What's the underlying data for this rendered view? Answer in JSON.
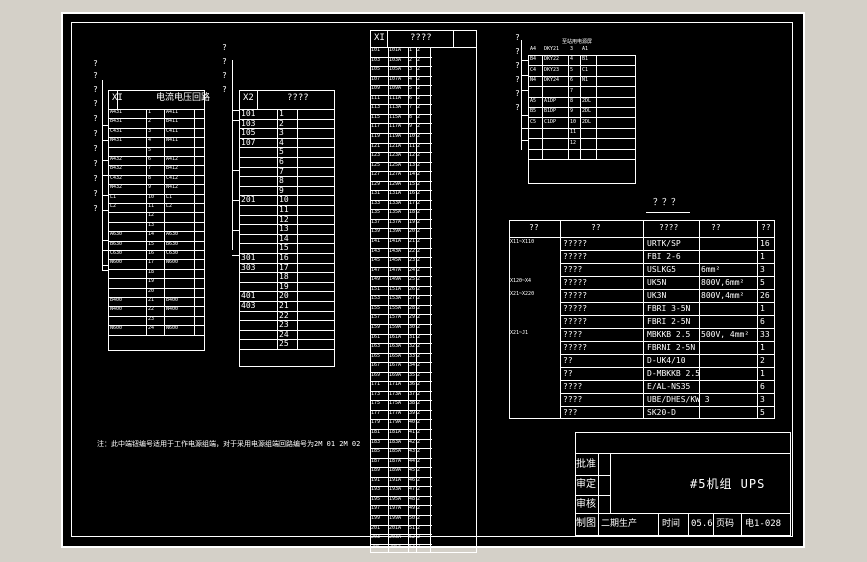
{
  "x1_table": {
    "header_left": "XI",
    "header_title": "电流电压回路",
    "rows": [
      [
        "A431",
        "1",
        "A411"
      ],
      [
        "B431",
        "2",
        "B411"
      ],
      [
        "C431",
        "3",
        "C411"
      ],
      [
        "N431",
        "4",
        "N411"
      ],
      [
        "",
        "5",
        ""
      ],
      [
        "A432",
        "6",
        "A412"
      ],
      [
        "B432",
        "7",
        "B412"
      ],
      [
        "C432",
        "8",
        "C412"
      ],
      [
        "N432",
        "9",
        "N412"
      ],
      [
        "L1",
        "10",
        "L1"
      ],
      [
        "L2",
        "11",
        "L2"
      ],
      [
        "",
        "12",
        ""
      ],
      [
        "",
        "13",
        ""
      ],
      [
        "A630",
        "14",
        "A630"
      ],
      [
        "B630",
        "15",
        "B630"
      ],
      [
        "C630",
        "16",
        "C630"
      ],
      [
        "N600",
        "17",
        "N600"
      ],
      [
        "",
        "18",
        ""
      ],
      [
        "",
        "19",
        ""
      ],
      [
        "",
        "20",
        ""
      ],
      [
        "B400",
        "21",
        "B400"
      ],
      [
        "N400",
        "22",
        "N400"
      ],
      [
        "",
        "23",
        ""
      ],
      [
        "N600",
        "24",
        "N600"
      ]
    ]
  },
  "x2_table": {
    "header_left": "X2",
    "header_title": "????",
    "rows": [
      [
        "101",
        "1",
        ""
      ],
      [
        "103",
        "2",
        ""
      ],
      [
        "105",
        "3",
        ""
      ],
      [
        "107",
        "4",
        ""
      ],
      [
        "",
        "5",
        ""
      ],
      [
        "",
        "6",
        ""
      ],
      [
        "",
        "7",
        ""
      ],
      [
        "",
        "8",
        ""
      ],
      [
        "",
        "9",
        ""
      ],
      [
        "201",
        "10",
        ""
      ],
      [
        "",
        "11",
        ""
      ],
      [
        "",
        "12",
        ""
      ],
      [
        "",
        "13",
        ""
      ],
      [
        "",
        "14",
        ""
      ],
      [
        "",
        "15",
        ""
      ],
      [
        "301",
        "16",
        ""
      ],
      [
        "303",
        "17",
        ""
      ],
      [
        "",
        "18",
        ""
      ],
      [
        "",
        "19",
        ""
      ],
      [
        "401",
        "20",
        ""
      ],
      [
        "403",
        "21",
        ""
      ],
      [
        "",
        "22",
        ""
      ],
      [
        "",
        "23",
        ""
      ],
      [
        "",
        "24",
        ""
      ],
      [
        "",
        "25",
        ""
      ]
    ]
  },
  "xi_table": {
    "header_left": "XI",
    "header_title": "????",
    "rows": [
      [
        "101",
        "101A",
        "1",
        "2"
      ],
      [
        "103",
        "103A",
        "2",
        "2"
      ],
      [
        "105",
        "105A",
        "3",
        "2"
      ],
      [
        "107",
        "107A",
        "4",
        "2"
      ],
      [
        "109",
        "109A",
        "5",
        "2"
      ],
      [
        "111",
        "111A",
        "6",
        "2"
      ],
      [
        "113",
        "113A",
        "7",
        "2"
      ],
      [
        "115",
        "115A",
        "8",
        "2"
      ],
      [
        "117",
        "117A",
        "9",
        "2"
      ],
      [
        "119",
        "119A",
        "10",
        "2"
      ],
      [
        "121",
        "121A",
        "11",
        "2"
      ],
      [
        "123",
        "123A",
        "12",
        "2"
      ],
      [
        "125",
        "125A",
        "13",
        "2"
      ],
      [
        "127",
        "127A",
        "14",
        "2"
      ],
      [
        "129",
        "129A",
        "15",
        "2"
      ],
      [
        "131",
        "131A",
        "16",
        "2"
      ],
      [
        "133",
        "133A",
        "17",
        "2"
      ],
      [
        "135",
        "135A",
        "18",
        "2"
      ],
      [
        "137",
        "137A",
        "19",
        "2"
      ],
      [
        "139",
        "139A",
        "20",
        "2"
      ],
      [
        "141",
        "141A",
        "21",
        "2"
      ],
      [
        "143",
        "143A",
        "22",
        "2"
      ],
      [
        "145",
        "145A",
        "23",
        "2"
      ],
      [
        "147",
        "147A",
        "24",
        "2"
      ],
      [
        "149",
        "149A",
        "25",
        "2"
      ],
      [
        "151",
        "151A",
        "26",
        "2"
      ],
      [
        "153",
        "153A",
        "27",
        "2"
      ],
      [
        "155",
        "155A",
        "28",
        "2"
      ],
      [
        "157",
        "157A",
        "29",
        "2"
      ],
      [
        "159",
        "159A",
        "30",
        "2"
      ],
      [
        "161",
        "161A",
        "31",
        "2"
      ],
      [
        "163",
        "163A",
        "32",
        "2"
      ],
      [
        "165",
        "165A",
        "33",
        "2"
      ],
      [
        "167",
        "167A",
        "34",
        "2"
      ],
      [
        "169",
        "169A",
        "35",
        "2"
      ],
      [
        "171",
        "171A",
        "36",
        "2"
      ],
      [
        "173",
        "173A",
        "37",
        "2"
      ],
      [
        "175",
        "175A",
        "38",
        "2"
      ],
      [
        "177",
        "177A",
        "39",
        "2"
      ],
      [
        "179",
        "179A",
        "40",
        "2"
      ],
      [
        "181",
        "181A",
        "41",
        "2"
      ],
      [
        "183",
        "183A",
        "42",
        "2"
      ],
      [
        "185",
        "185A",
        "43",
        "2"
      ],
      [
        "187",
        "187A",
        "44",
        "2"
      ],
      [
        "189",
        "189A",
        "45",
        "2"
      ],
      [
        "191",
        "191A",
        "46",
        "2"
      ],
      [
        "193",
        "193A",
        "47",
        "2"
      ],
      [
        "195",
        "195A",
        "48",
        "2"
      ],
      [
        "197",
        "197A",
        "49",
        "2"
      ],
      [
        "199",
        "199A",
        "50",
        "2"
      ],
      [
        "201",
        "201A",
        "51",
        "2"
      ],
      [
        "203",
        "203A",
        "52",
        "2"
      ],
      [
        "205",
        "205A",
        "53",
        "2"
      ]
    ]
  },
  "small_table": {
    "header": "至站用电源屏",
    "rows": [
      [
        "A4",
        "DKY21",
        "3",
        "A1"
      ],
      [
        "B4",
        "DKY22",
        "4",
        "B1"
      ],
      [
        "C4",
        "DKY23",
        "5",
        "C1"
      ],
      [
        "N4",
        "DKY24",
        "6",
        "N1"
      ],
      [
        "",
        "",
        "7",
        ""
      ],
      [
        "A5",
        "A1DP",
        "8",
        "2DL"
      ],
      [
        "B5",
        "B1DP",
        "9",
        "2DL"
      ],
      [
        "C5",
        "C1DP",
        "10",
        "2DL"
      ],
      [
        "",
        "",
        "11",
        ""
      ],
      [
        "",
        "",
        "12",
        ""
      ]
    ]
  },
  "material_table": {
    "caption": "？？？",
    "headers": [
      "??",
      "??",
      "????",
      "??"
    ],
    "rows": [
      {
        "a": "X11~X110",
        "b": "?????",
        "c": "URTK/SP",
        "d": "",
        "e": "16"
      },
      {
        "a": "",
        "b": "?????",
        "c": "FBI 2-6",
        "d": "",
        "e": "1"
      },
      {
        "a": "",
        "b": "????",
        "c": "USLKG5",
        "d": "6mm²",
        "e": "3"
      },
      {
        "a": "X120~X4",
        "b": "?????",
        "c": "UK5N",
        "d": "800V,6mm²",
        "e": "5"
      },
      {
        "a": "X21~X220",
        "b": "?????",
        "c": "UK3N",
        "d": "800V,4mm²",
        "e": "26"
      },
      {
        "a": "",
        "b": "?????",
        "c": "FBRI 3-5N",
        "d": "",
        "e": "1"
      },
      {
        "a": "",
        "b": "?????",
        "c": "FBRI 2-5N",
        "d": "",
        "e": "6"
      },
      {
        "a": "X21~J1",
        "b": "????",
        "c": "MBKKB 2.5",
        "d": "500V, 4mm²",
        "e": "33"
      },
      {
        "a": "",
        "b": "?????",
        "c": "FBRNI 2-5N",
        "d": "",
        "e": "1"
      },
      {
        "a": "",
        "b": "??",
        "c": "D-UK4/10",
        "d": "",
        "e": "2"
      },
      {
        "a": "",
        "b": "??",
        "c": "D-MBKKB 2.5",
        "d": "",
        "e": "1"
      },
      {
        "a": "",
        "b": "????",
        "c": "E/AL-NS35",
        "d": "",
        "e": "6"
      },
      {
        "a": "",
        "b": "????",
        "c": "UBE/DHES/KW 3",
        "d": "",
        "e": "3"
      },
      {
        "a": "",
        "b": "???",
        "c": "SK20-D",
        "d": "",
        "e": "5"
      }
    ]
  },
  "title_block": {
    "approve": "批准",
    "review": "审定",
    "check": "审核",
    "draw": "制图",
    "designer": "二期生产",
    "project": "#5机组 UPS",
    "time_label": "时间",
    "time_value": "05.6",
    "page_label": "页码",
    "page_value": "电1-028"
  },
  "note": "注：此中端钮编号适用于工作电源组端，对于采用电源组端回路编号为2M 01 2M 02",
  "question_marks": "?"
}
